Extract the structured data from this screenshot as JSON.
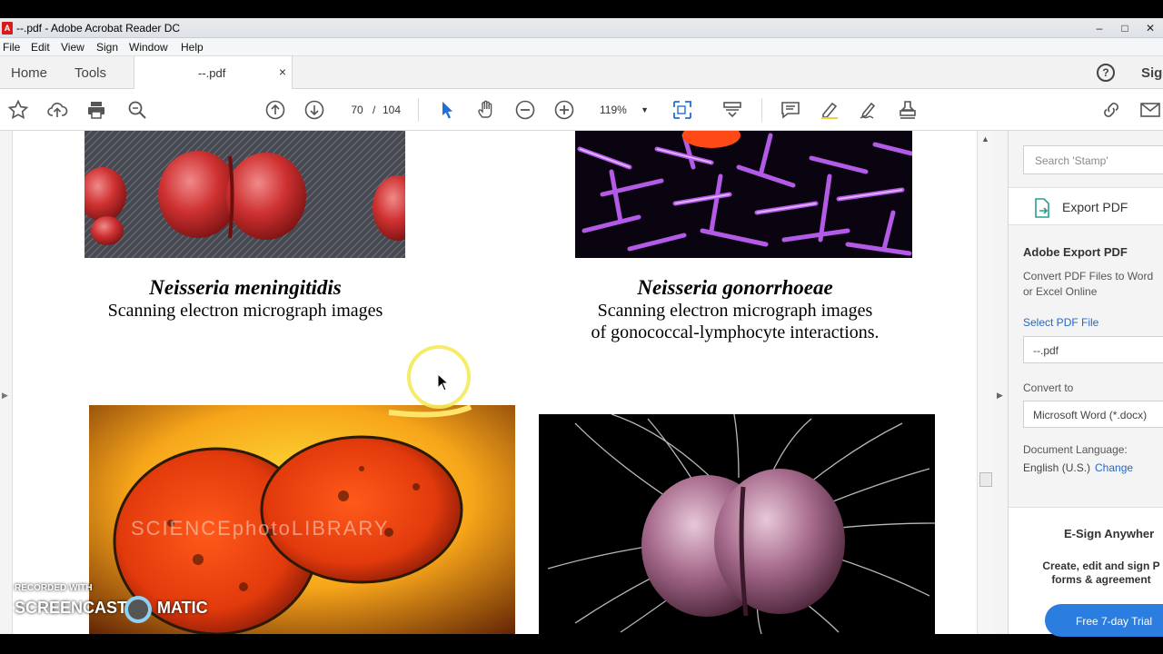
{
  "window": {
    "title": "--.pdf - Adobe Acrobat Reader DC",
    "app_icon": "acrobat-icon",
    "controls": [
      "–",
      "□",
      "✕"
    ]
  },
  "menu": [
    "File",
    "Edit",
    "View",
    "Sign",
    "Window",
    "Help"
  ],
  "tabs": {
    "home": "Home",
    "tools": "Tools",
    "document": "--.pdf",
    "close": "×",
    "help": "?",
    "sign_in": "Sig"
  },
  "toolbar": {
    "page_current": "70",
    "page_separator": "/",
    "page_total": "104",
    "zoom": "119%",
    "icons": [
      "bookmark-star-icon",
      "upload-cloud-icon",
      "print-icon",
      "find-icon",
      "page-up-icon",
      "page-down-icon",
      "select-arrow-icon",
      "hand-icon",
      "zoom-out-icon",
      "zoom-in-icon",
      "fit-page-icon",
      "scroll-mode-icon",
      "comment-icon",
      "highlight-pen-icon",
      "sign-pen-icon",
      "stamp-icon",
      "share-link-icon",
      "email-icon"
    ]
  },
  "document": {
    "caption1": {
      "species": "Neisseria meningitidis",
      "line1": "Scanning electron micrograph images"
    },
    "caption2": {
      "species": "Neisseria gonorrhoeae",
      "line1": "Scanning electron micrograph images",
      "line2": "of gonococcal-lymphocyte interactions."
    },
    "image_watermark": "SCIENCEphotoLIBRARY"
  },
  "right_panel": {
    "search_placeholder": "Search 'Stamp'",
    "export_button": "Export PDF",
    "heading": "Adobe Export PDF",
    "description": "Convert PDF Files to Word or Excel Online",
    "select_file_link": "Select PDF File",
    "selected_file": "--.pdf",
    "convert_to_label": "Convert to",
    "convert_to_value": "Microsoft Word (*.docx)",
    "doc_language_label": "Document Language:",
    "doc_language_value": "English (U.S.)",
    "change_link": "Change",
    "esign_title": "E-Sign Anywher",
    "esign_desc_line1": "Create, edit and sign P",
    "esign_desc_line2": "forms & agreement",
    "trial_button": "Free 7-day Trial"
  },
  "recording_watermark": {
    "line1": "RECORDED WITH",
    "brand_left": "SCREENCAST",
    "brand_right": "MATIC"
  }
}
